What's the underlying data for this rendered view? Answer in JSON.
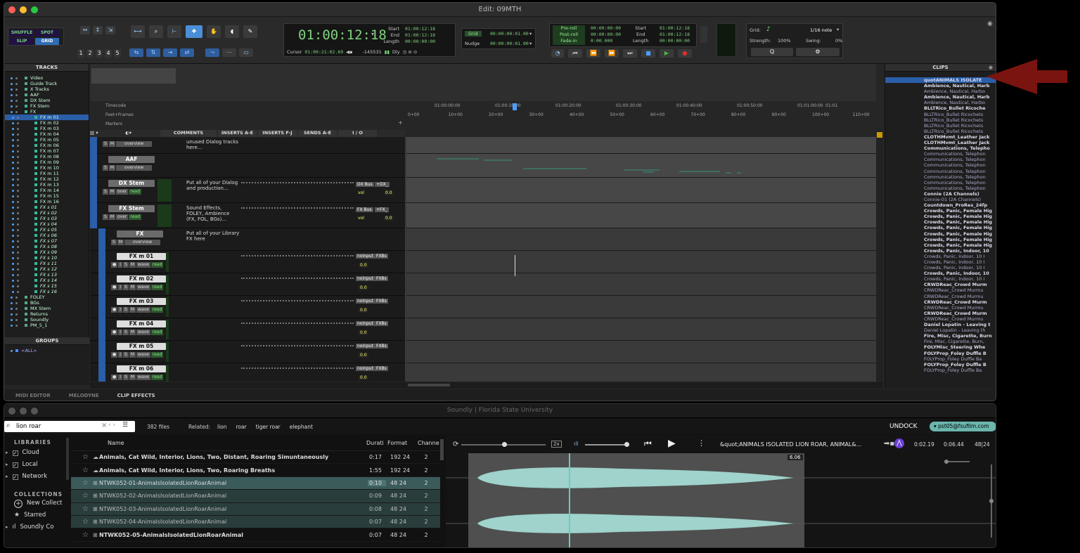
{
  "window": {
    "title": "Edit: 09MTH"
  },
  "toolbar": {
    "modes": {
      "shuffle": "SHUFFLE",
      "spot": "SPOT",
      "slip": "SLIP",
      "grid": "GRID"
    },
    "zoom_presets": [
      "1",
      "2",
      "3",
      "4",
      "5"
    ],
    "main_counter": "01:00:12:18",
    "sel_labels": [
      "Start",
      "End",
      "Length"
    ],
    "sel_values": [
      "01:00:12:18",
      "01:00:12:18",
      "00:00:00:00"
    ],
    "cursor_label": "Cursor",
    "cursor_value": "01:00:21:02.69",
    "sample_value": "-145531",
    "dly_label": "Dly",
    "grid_label": "Grid",
    "grid_value": "00:00:00:01.00",
    "nudge_label": "Nudge",
    "nudge_value": "00:00:00:01.00",
    "preroll_labels": [
      "Pre-roll",
      "Post-roll",
      "Fade-in"
    ],
    "preroll_values": [
      "00:00:00:00",
      "00:00:00:00",
      "0:00.000"
    ],
    "trans_labels": [
      "Start",
      "End",
      "Length"
    ],
    "trans_values": [
      "01:00:12:18",
      "01:00:12:18",
      "00:00:00:00"
    ],
    "gridpanel": {
      "grid": "Grid:",
      "note": "1/16 note",
      "strength": "Strength:",
      "strength_value": "100%",
      "swing": "Swing:",
      "swing_value": "0%"
    }
  },
  "tracks_panel": {
    "title": "TRACKS",
    "items": [
      "Video",
      "Guide Track",
      "X Tracks",
      "AAF",
      "DX Stem",
      "FX Stem",
      "FX",
      "FX m 01",
      "FX m 02",
      "FX m 03",
      "FX m 04",
      "FX m 05",
      "FX m 06",
      "FX m 07",
      "FX m 08",
      "FX m 09",
      "FX m 10",
      "FX m 11",
      "FX m 12",
      "FX m 13",
      "FX m 14",
      "FX m 15",
      "FX m 16",
      "FX s 01",
      "FX s 02",
      "FX s 03",
      "FX s 04",
      "FX s 05",
      "FX s 06",
      "FX s 07",
      "FX s 08",
      "FX s 09",
      "FX s 10",
      "FX s 11",
      "FX s 12",
      "FX s 13",
      "FX s 14",
      "FX s 15",
      "FX s 16",
      "FOLEY",
      "BGs",
      "MX Stem",
      "Returns",
      "Soundly",
      "PM_5_1"
    ]
  },
  "groups_panel": {
    "title": "GROUPS",
    "items": [
      "<ALL>"
    ]
  },
  "rulers": {
    "timecode": "Timecode",
    "feet": "Feet+Frames",
    "markers": "Markers",
    "tc_ticks": [
      "01:00:00:00",
      "01:00:10:00",
      "01:00:20:00",
      "01:00:30:00",
      "01:00:40:00",
      "01:00:50:00",
      "01:01:00:00",
      "01:01"
    ],
    "ff_ticks": [
      "0+00",
      "10+00",
      "20+00",
      "30+00",
      "40+00",
      "50+00",
      "60+00",
      "70+00",
      "80+00",
      "90+00",
      "100+00",
      "110+00"
    ]
  },
  "columns": [
    "COMMENTS",
    "INSERTS A-E",
    "INSERTS F-J",
    "SENDS A-E",
    "I / O"
  ],
  "edit_tracks": [
    {
      "name": "",
      "btns": [
        "S",
        "M",
        "overview"
      ],
      "comment": "unused Dialog tracks here..."
    },
    {
      "name": "AAF",
      "btns": [
        "S",
        "M",
        "overview"
      ],
      "comment": ""
    },
    {
      "name": "DX Stem",
      "btns": [
        "S",
        "M",
        "over",
        "read"
      ],
      "comment": "Put all of your Dialog and production...",
      "io": [
        "DX Bus",
        "+DX_"
      ],
      "vol": "vol",
      "vol_val": "0.0"
    },
    {
      "name": "FX Stem",
      "btns": [
        "S",
        "M",
        "over",
        "read"
      ],
      "comment": "Sound Effects, FOLEY, Ambience (FX, FOL, BGs)...",
      "io": [
        "FX Bus",
        "+FX_"
      ],
      "vol": "vol",
      "vol_val": "0.0"
    },
    {
      "name": "FX",
      "btns": [
        "S",
        "M",
        "overview"
      ],
      "comment": "Put all of your Library FX here"
    },
    {
      "name": "FX m 01",
      "btns": [
        "●",
        "I",
        "S",
        "M",
        "wave",
        "read"
      ],
      "io": [
        "noinput",
        "FXBs"
      ],
      "vol_val": "0.0"
    },
    {
      "name": "FX m 02",
      "btns": [
        "●",
        "I",
        "S",
        "M",
        "wave",
        "read"
      ],
      "io": [
        "noinput",
        "FXBs"
      ],
      "vol_val": "0.0"
    },
    {
      "name": "FX m 03",
      "btns": [
        "●",
        "I",
        "S",
        "M",
        "wave",
        "read"
      ],
      "io": [
        "noinput",
        "FXBs"
      ],
      "vol_val": "0.0"
    },
    {
      "name": "FX m 04",
      "btns": [
        "●",
        "I",
        "S",
        "M",
        "wave",
        "read"
      ],
      "io": [
        "noinput",
        "FXBs"
      ],
      "vol_val": "0.0"
    },
    {
      "name": "FX m 05",
      "btns": [
        "●",
        "I",
        "S",
        "M",
        "wave",
        "read"
      ],
      "io": [
        "noinput",
        "FXBs"
      ],
      "vol_val": "0.0"
    },
    {
      "name": "FX m 06",
      "btns": [
        "●",
        "I",
        "S",
        "M",
        "wave",
        "read"
      ],
      "io": [
        "noinput",
        "FXBs"
      ],
      "vol_val": "0.0"
    }
  ],
  "bottom_tabs": [
    "MIDI EDITOR",
    "MELODYNE",
    "CLIP EFFECTS"
  ],
  "clips_panel": {
    "title": "CLIPS",
    "items": [
      "quotANIMALS  ISOLATE",
      "Ambience, Nautical, Harb",
      "Ambience, Nautical, Harbo",
      "Ambience, Nautical, Harb",
      "Ambience, Nautical, Harbo",
      "BLLTRico_Bullet Ricoche",
      "BLLTRico_Bullet Ricochets",
      "BLLTRico_Bullet Ricochets",
      "BLLTRico_Bullet Ricochets",
      "BLLTRico_Bullet Ricochets",
      "CLOTHMvmt_Leather Jack",
      "CLOTHMvmt_Leather Jack",
      "Communications, Telepho",
      "Communications, Telephon",
      "Communications, Telephon",
      "Communications, Telephon",
      "Communications, Telephon",
      "Communications, Telephon",
      "Communications, Telephon",
      "Communications, Telephon",
      "Connie (2A Channels)",
      "Connie-01 (2A Channels)",
      "Countdown_ProRes_24fp",
      "Crowds, Panic, Female Hig",
      "Crowds, Panic, Female Hig",
      "Crowds, Panic, Female Hig",
      "Crowds, Panic, Female Hig",
      "Crowds, Panic, Female Hig",
      "Crowds, Panic, Female Hig",
      "Crowds, Panic, Female Hig",
      "Crowds, Panic, Indoor, 10",
      "Crowds, Panic, Indoor, 10 I",
      "Crowds, Panic, Indoor, 10 I",
      "Crowds, Panic, Indoor, 10 I",
      "Crowds, Panic, Indoor, 10",
      "Crowds, Panic, Indoor, 10 I",
      "CRWDReac_Crowd Murm",
      "CRWDReac_Crowd Murmu",
      "CRWDReac_Crowd Murmu",
      "CRWDReac_Crowd Murm",
      "CRWDReac_Crowd Murmu",
      "CRWDReac_Crowd Murm",
      "CRWDReac_Crowd Murmu",
      "Daniel Lopatin - Leaving t",
      "Daniel Lopatin - Leaving th",
      "Fire, Misc, Cigarette, Burn",
      "Fire, Misc, Cigarette, Burn,",
      "FOLYMisc_Steering Whe",
      "FOLYProp_Foley Duffle B",
      "FOLYProp_Foley Duffle Ba",
      "FOLYProp_Foley Duffle B",
      "FOLYProp_Foley Duffle Ba"
    ]
  },
  "soundly": {
    "title": "Soundly | Florida State University",
    "search_value": "lion roar",
    "file_count": "382 files",
    "related_label": "Related:",
    "related": [
      "lion",
      "roar",
      "tiger roar",
      "elephant"
    ],
    "undock": "UNDOCK",
    "user": "pst05@fsufilm.com",
    "libraries_label": "LIBRARIES",
    "libraries": [
      "Cloud",
      "Local",
      "Network"
    ],
    "collections_label": "COLLECTIONS",
    "collections": [
      "New Collect",
      "Starred",
      "Soundly Co"
    ],
    "headers": {
      "name": "Name",
      "duration": "Durati",
      "format": "Format",
      "channels": "Channe"
    },
    "results": [
      {
        "name": "Animals, Cat Wild, Interior, Lions, Two, Distant, Roaring Simuntaneously",
        "dur": "0:17",
        "fmt": "192 24",
        "ch": "2"
      },
      {
        "name": "Animals, Cat Wild, Interior, Lions, Two, Roaring Breaths",
        "dur": "1:55",
        "fmt": "192 24",
        "ch": "2"
      },
      {
        "name": "NTWK052-01-AnimalsIsolatedLionRoarAnimal",
        "dur": "0:10",
        "fmt": "48 24",
        "ch": "2"
      },
      {
        "name": "NTWK052-02-AnimalsIsolatedLionRoarAnimal",
        "dur": "0:09",
        "fmt": "48 24",
        "ch": "2"
      },
      {
        "name": "NTWK052-03-AnimalsIsolatedLionRoarAnimal",
        "dur": "0:08",
        "fmt": "48 24",
        "ch": "2"
      },
      {
        "name": "NTWK052-04-AnimalsIsolatedLionRoarAnimal",
        "dur": "0:07",
        "fmt": "48 24",
        "ch": "2"
      },
      {
        "name": "NTWK052-05-AnimalsIsolatedLionRoarAnimal",
        "dur": "0:07",
        "fmt": "48 24",
        "ch": "2"
      }
    ],
    "speed": "2x",
    "player_title": "&quot;ANIMALS     ISOLATED LION ROAR, ANIMAL&...",
    "pos": "0:02.19",
    "length": "0:06.44",
    "rate": "48|24",
    "marker": "6.06"
  },
  "colors": {
    "accent": "#4a9eff",
    "record": "#e0302a",
    "play": "#3fbf3f",
    "waveform": "#9fd3cc",
    "arrow": "#7a1410"
  }
}
